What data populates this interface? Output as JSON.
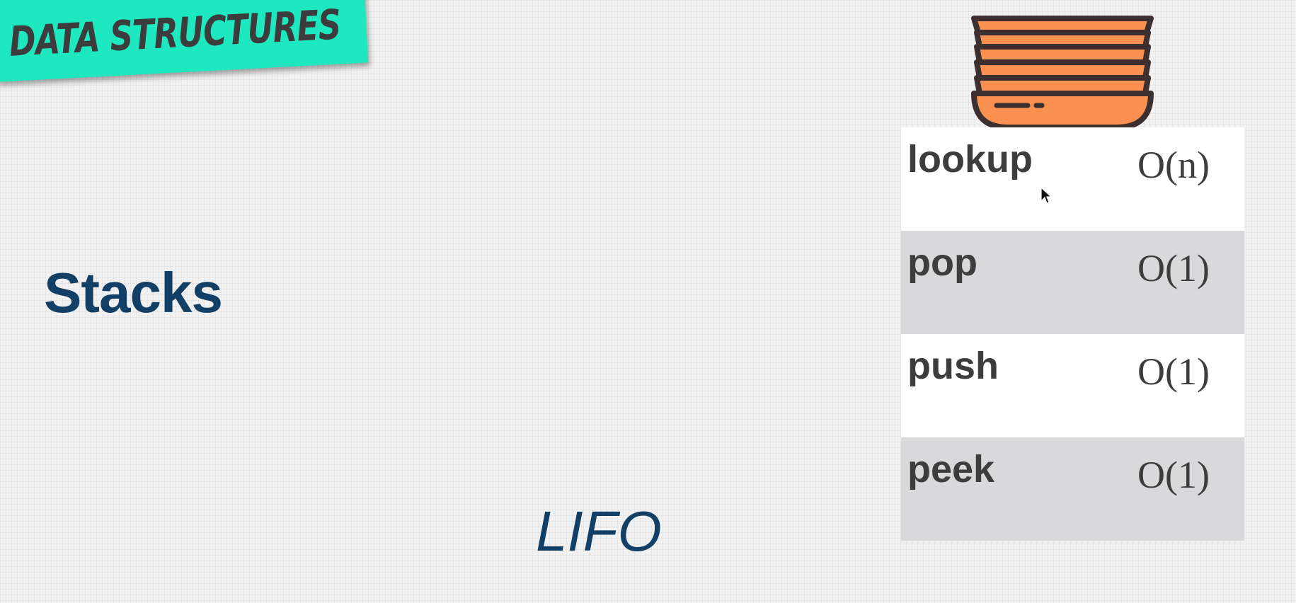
{
  "banner": {
    "label": "DATA STRUCTURES"
  },
  "slide": {
    "title": "Stacks",
    "subtitle": "LIFO"
  },
  "operations": [
    {
      "name": "lookup",
      "cost": "O(n)"
    },
    {
      "name": "pop",
      "cost": "O(1)"
    },
    {
      "name": "push",
      "cost": "O(1)"
    },
    {
      "name": "peek",
      "cost": "O(1)"
    }
  ],
  "colors": {
    "title": "#123f66",
    "banner": "#1ee8c0",
    "banner_top": "#f5e04a",
    "plates_fill": "#fa9150",
    "plates_outline": "#3c2f2f",
    "row_alt": "#d9d9dc"
  },
  "icons": {
    "stack": "stack-of-plates-icon",
    "cursor": "mouse-cursor-icon"
  }
}
